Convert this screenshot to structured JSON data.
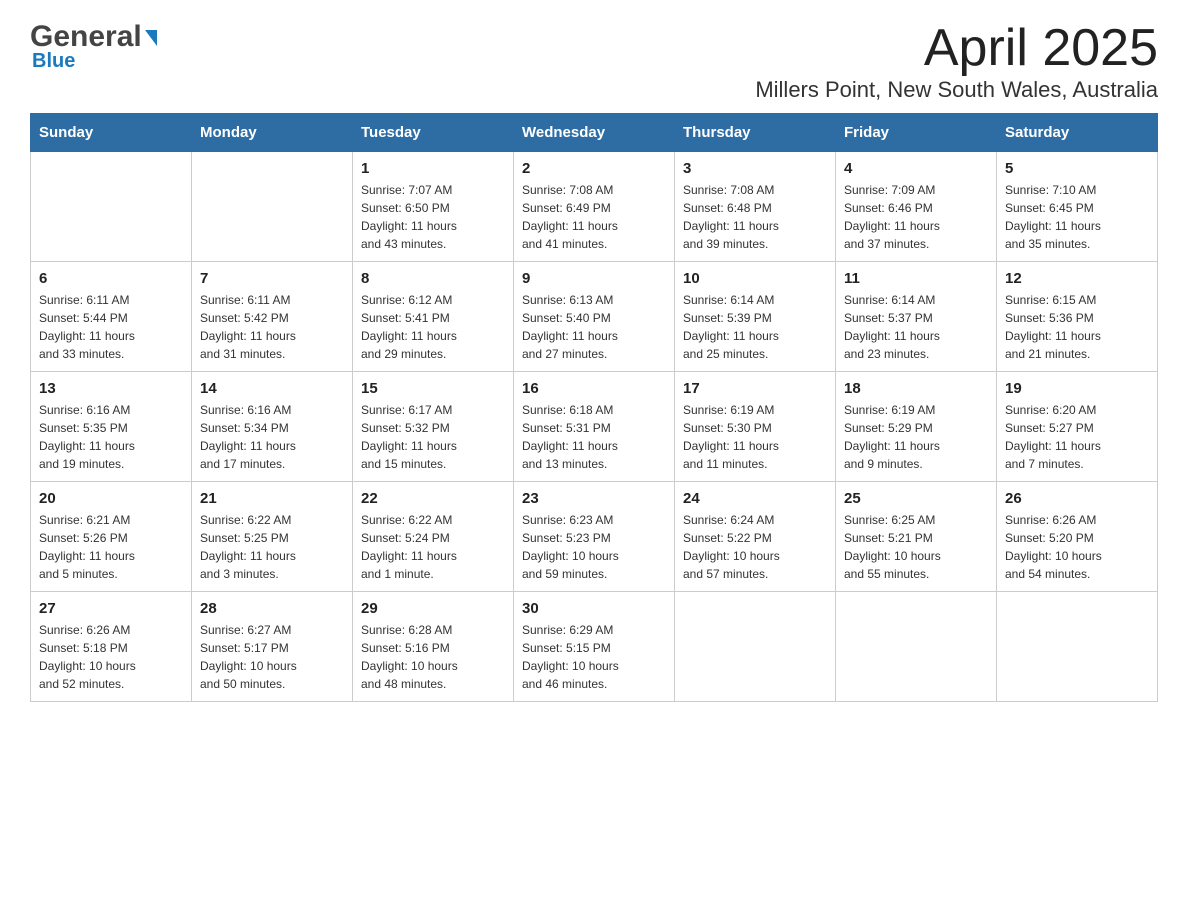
{
  "logo": {
    "line1_black": "General",
    "line1_blue": "▶",
    "line2": "Blue"
  },
  "title": {
    "month_year": "April 2025",
    "location": "Millers Point, New South Wales, Australia"
  },
  "weekdays": [
    "Sunday",
    "Monday",
    "Tuesday",
    "Wednesday",
    "Thursday",
    "Friday",
    "Saturday"
  ],
  "weeks": [
    [
      {
        "day": "",
        "info": ""
      },
      {
        "day": "",
        "info": ""
      },
      {
        "day": "1",
        "info": "Sunrise: 7:07 AM\nSunset: 6:50 PM\nDaylight: 11 hours\nand 43 minutes."
      },
      {
        "day": "2",
        "info": "Sunrise: 7:08 AM\nSunset: 6:49 PM\nDaylight: 11 hours\nand 41 minutes."
      },
      {
        "day": "3",
        "info": "Sunrise: 7:08 AM\nSunset: 6:48 PM\nDaylight: 11 hours\nand 39 minutes."
      },
      {
        "day": "4",
        "info": "Sunrise: 7:09 AM\nSunset: 6:46 PM\nDaylight: 11 hours\nand 37 minutes."
      },
      {
        "day": "5",
        "info": "Sunrise: 7:10 AM\nSunset: 6:45 PM\nDaylight: 11 hours\nand 35 minutes."
      }
    ],
    [
      {
        "day": "6",
        "info": "Sunrise: 6:11 AM\nSunset: 5:44 PM\nDaylight: 11 hours\nand 33 minutes."
      },
      {
        "day": "7",
        "info": "Sunrise: 6:11 AM\nSunset: 5:42 PM\nDaylight: 11 hours\nand 31 minutes."
      },
      {
        "day": "8",
        "info": "Sunrise: 6:12 AM\nSunset: 5:41 PM\nDaylight: 11 hours\nand 29 minutes."
      },
      {
        "day": "9",
        "info": "Sunrise: 6:13 AM\nSunset: 5:40 PM\nDaylight: 11 hours\nand 27 minutes."
      },
      {
        "day": "10",
        "info": "Sunrise: 6:14 AM\nSunset: 5:39 PM\nDaylight: 11 hours\nand 25 minutes."
      },
      {
        "day": "11",
        "info": "Sunrise: 6:14 AM\nSunset: 5:37 PM\nDaylight: 11 hours\nand 23 minutes."
      },
      {
        "day": "12",
        "info": "Sunrise: 6:15 AM\nSunset: 5:36 PM\nDaylight: 11 hours\nand 21 minutes."
      }
    ],
    [
      {
        "day": "13",
        "info": "Sunrise: 6:16 AM\nSunset: 5:35 PM\nDaylight: 11 hours\nand 19 minutes."
      },
      {
        "day": "14",
        "info": "Sunrise: 6:16 AM\nSunset: 5:34 PM\nDaylight: 11 hours\nand 17 minutes."
      },
      {
        "day": "15",
        "info": "Sunrise: 6:17 AM\nSunset: 5:32 PM\nDaylight: 11 hours\nand 15 minutes."
      },
      {
        "day": "16",
        "info": "Sunrise: 6:18 AM\nSunset: 5:31 PM\nDaylight: 11 hours\nand 13 minutes."
      },
      {
        "day": "17",
        "info": "Sunrise: 6:19 AM\nSunset: 5:30 PM\nDaylight: 11 hours\nand 11 minutes."
      },
      {
        "day": "18",
        "info": "Sunrise: 6:19 AM\nSunset: 5:29 PM\nDaylight: 11 hours\nand 9 minutes."
      },
      {
        "day": "19",
        "info": "Sunrise: 6:20 AM\nSunset: 5:27 PM\nDaylight: 11 hours\nand 7 minutes."
      }
    ],
    [
      {
        "day": "20",
        "info": "Sunrise: 6:21 AM\nSunset: 5:26 PM\nDaylight: 11 hours\nand 5 minutes."
      },
      {
        "day": "21",
        "info": "Sunrise: 6:22 AM\nSunset: 5:25 PM\nDaylight: 11 hours\nand 3 minutes."
      },
      {
        "day": "22",
        "info": "Sunrise: 6:22 AM\nSunset: 5:24 PM\nDaylight: 11 hours\nand 1 minute."
      },
      {
        "day": "23",
        "info": "Sunrise: 6:23 AM\nSunset: 5:23 PM\nDaylight: 10 hours\nand 59 minutes."
      },
      {
        "day": "24",
        "info": "Sunrise: 6:24 AM\nSunset: 5:22 PM\nDaylight: 10 hours\nand 57 minutes."
      },
      {
        "day": "25",
        "info": "Sunrise: 6:25 AM\nSunset: 5:21 PM\nDaylight: 10 hours\nand 55 minutes."
      },
      {
        "day": "26",
        "info": "Sunrise: 6:26 AM\nSunset: 5:20 PM\nDaylight: 10 hours\nand 54 minutes."
      }
    ],
    [
      {
        "day": "27",
        "info": "Sunrise: 6:26 AM\nSunset: 5:18 PM\nDaylight: 10 hours\nand 52 minutes."
      },
      {
        "day": "28",
        "info": "Sunrise: 6:27 AM\nSunset: 5:17 PM\nDaylight: 10 hours\nand 50 minutes."
      },
      {
        "day": "29",
        "info": "Sunrise: 6:28 AM\nSunset: 5:16 PM\nDaylight: 10 hours\nand 48 minutes."
      },
      {
        "day": "30",
        "info": "Sunrise: 6:29 AM\nSunset: 5:15 PM\nDaylight: 10 hours\nand 46 minutes."
      },
      {
        "day": "",
        "info": ""
      },
      {
        "day": "",
        "info": ""
      },
      {
        "day": "",
        "info": ""
      }
    ]
  ]
}
